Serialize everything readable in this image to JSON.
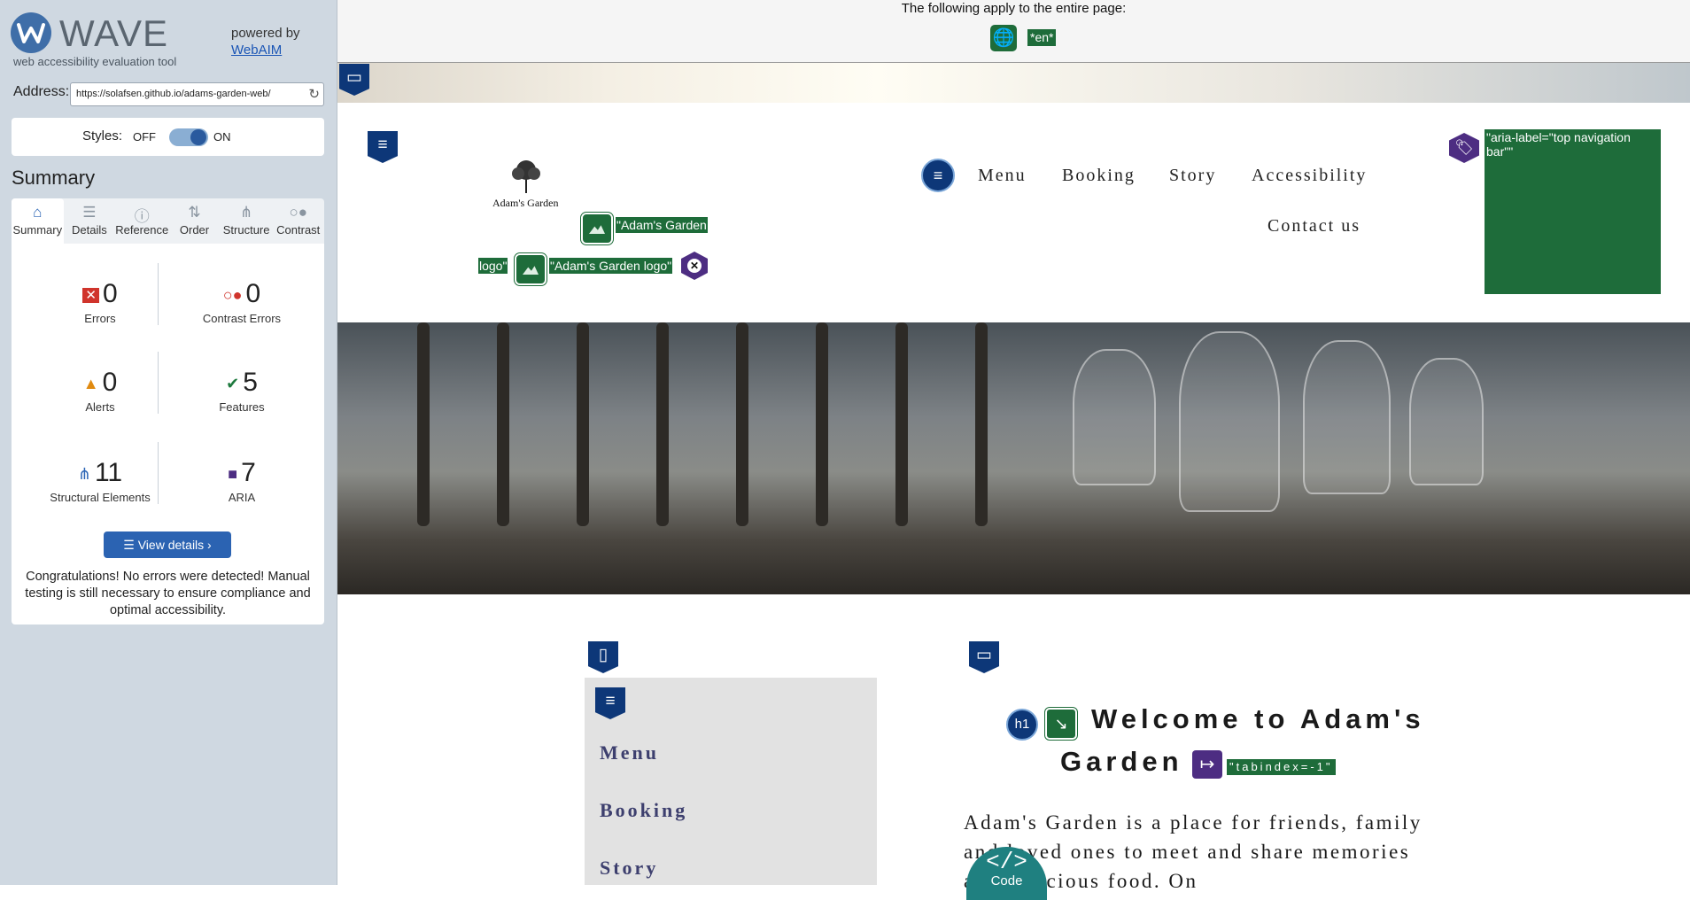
{
  "wave": {
    "brand": "WAVE",
    "tagline": "web accessibility evaluation tool",
    "powered_by": "powered by",
    "webaim_link": "WebAIM",
    "address_label": "Address:",
    "address_value": "https://solafsen.github.io/adams-garden-web/",
    "styles_label": "Styles:",
    "styles_off": "OFF",
    "styles_on": "ON",
    "styles_state": "on",
    "summary_title": "Summary",
    "tabs": [
      {
        "label": "Summary",
        "icon": "home-icon",
        "active": true
      },
      {
        "label": "Details",
        "icon": "list-icon"
      },
      {
        "label": "Reference",
        "icon": "info-icon"
      },
      {
        "label": "Order",
        "icon": "order-icon"
      },
      {
        "label": "Structure",
        "icon": "structure-icon"
      },
      {
        "label": "Contrast",
        "icon": "contrast-icon"
      }
    ],
    "stats": {
      "errors": {
        "count": "0",
        "label": "Errors",
        "color": "#d0342c"
      },
      "contrast_errors": {
        "count": "0",
        "label": "Contrast Errors",
        "color": "#d0342c"
      },
      "alerts": {
        "count": "0",
        "label": "Alerts",
        "color": "#e08a10"
      },
      "features": {
        "count": "5",
        "label": "Features",
        "color": "#1e7a3e"
      },
      "structural": {
        "count": "11",
        "label": "Structural Elements",
        "color": "#2a64b5"
      },
      "aria": {
        "count": "7",
        "label": "ARIA",
        "color": "#4d2d82"
      }
    },
    "view_details": "View details ›",
    "congrats": "Congratulations! No errors were detected! Manual testing is still necessary to ensure compliance and optimal accessibility."
  },
  "page_banner": {
    "text": "The following apply to the entire page:",
    "lang_tag": "*en*"
  },
  "site": {
    "logo_text": "Adam's Garden",
    "alt_label_1": "\"Adam's Garden",
    "alt_label_1b": "logo\"",
    "alt_label_2": "\"Adam's Garden logo\"",
    "nav": [
      "Menu",
      "Booking",
      "Story",
      "Accessibility",
      "Contact us"
    ],
    "aria_label": "\"aria-label=\"top navigation bar\"\"",
    "side_nav": [
      "Menu",
      "Booking",
      "Story"
    ],
    "h1_line1": "Welcome to Adam's",
    "h1_line2": "Garden",
    "h1_badge": "h1",
    "tabindex_tag": "\"tabindex=-1\"",
    "paragraph": "Adam's Garden is a place for friends, family and loved ones to meet and share memories and delicious food. On"
  },
  "code_button": {
    "label": "Code",
    "glyph": "</>"
  },
  "colors": {
    "sidebar_bg": "#cfd8e1",
    "wave_blue": "#0d3778",
    "feature_green": "#1e6c3a",
    "aria_purple": "#4d2d82",
    "code_teal": "#1f8080"
  }
}
